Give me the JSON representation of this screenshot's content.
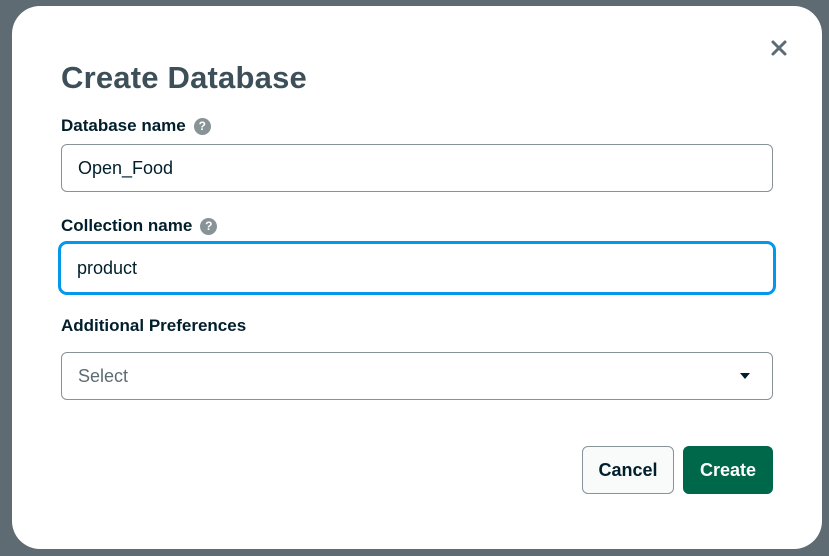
{
  "dialog": {
    "title": "Create Database",
    "close_icon": "close-icon"
  },
  "fields": {
    "database_name": {
      "label": "Database name",
      "help_icon": "help-icon",
      "help_glyph": "?",
      "value": "Open_Food"
    },
    "collection_name": {
      "label": "Collection name",
      "help_icon": "help-icon",
      "help_glyph": "?",
      "value": "product",
      "focused": true
    },
    "additional_preferences": {
      "label": "Additional Preferences",
      "placeholder": "Select",
      "icon": "chevron-down-icon"
    }
  },
  "actions": {
    "cancel_label": "Cancel",
    "create_label": "Create"
  },
  "colors": {
    "primary": "#00684a",
    "focus_ring": "#0498ec",
    "title_text": "#3d4f58",
    "border": "#889397"
  }
}
